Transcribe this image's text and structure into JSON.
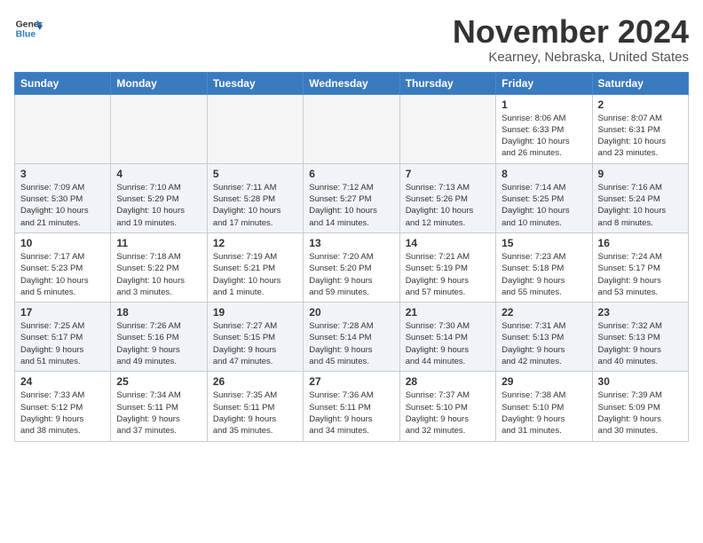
{
  "header": {
    "logo_general": "General",
    "logo_blue": "Blue",
    "month_title": "November 2024",
    "location": "Kearney, Nebraska, United States"
  },
  "weekdays": [
    "Sunday",
    "Monday",
    "Tuesday",
    "Wednesday",
    "Thursday",
    "Friday",
    "Saturday"
  ],
  "weeks": [
    [
      {
        "day": "",
        "info": ""
      },
      {
        "day": "",
        "info": ""
      },
      {
        "day": "",
        "info": ""
      },
      {
        "day": "",
        "info": ""
      },
      {
        "day": "",
        "info": ""
      },
      {
        "day": "1",
        "info": "Sunrise: 8:06 AM\nSunset: 6:33 PM\nDaylight: 10 hours\nand 26 minutes."
      },
      {
        "day": "2",
        "info": "Sunrise: 8:07 AM\nSunset: 6:31 PM\nDaylight: 10 hours\nand 23 minutes."
      }
    ],
    [
      {
        "day": "3",
        "info": "Sunrise: 7:09 AM\nSunset: 5:30 PM\nDaylight: 10 hours\nand 21 minutes."
      },
      {
        "day": "4",
        "info": "Sunrise: 7:10 AM\nSunset: 5:29 PM\nDaylight: 10 hours\nand 19 minutes."
      },
      {
        "day": "5",
        "info": "Sunrise: 7:11 AM\nSunset: 5:28 PM\nDaylight: 10 hours\nand 17 minutes."
      },
      {
        "day": "6",
        "info": "Sunrise: 7:12 AM\nSunset: 5:27 PM\nDaylight: 10 hours\nand 14 minutes."
      },
      {
        "day": "7",
        "info": "Sunrise: 7:13 AM\nSunset: 5:26 PM\nDaylight: 10 hours\nand 12 minutes."
      },
      {
        "day": "8",
        "info": "Sunrise: 7:14 AM\nSunset: 5:25 PM\nDaylight: 10 hours\nand 10 minutes."
      },
      {
        "day": "9",
        "info": "Sunrise: 7:16 AM\nSunset: 5:24 PM\nDaylight: 10 hours\nand 8 minutes."
      }
    ],
    [
      {
        "day": "10",
        "info": "Sunrise: 7:17 AM\nSunset: 5:23 PM\nDaylight: 10 hours\nand 5 minutes."
      },
      {
        "day": "11",
        "info": "Sunrise: 7:18 AM\nSunset: 5:22 PM\nDaylight: 10 hours\nand 3 minutes."
      },
      {
        "day": "12",
        "info": "Sunrise: 7:19 AM\nSunset: 5:21 PM\nDaylight: 10 hours\nand 1 minute."
      },
      {
        "day": "13",
        "info": "Sunrise: 7:20 AM\nSunset: 5:20 PM\nDaylight: 9 hours\nand 59 minutes."
      },
      {
        "day": "14",
        "info": "Sunrise: 7:21 AM\nSunset: 5:19 PM\nDaylight: 9 hours\nand 57 minutes."
      },
      {
        "day": "15",
        "info": "Sunrise: 7:23 AM\nSunset: 5:18 PM\nDaylight: 9 hours\nand 55 minutes."
      },
      {
        "day": "16",
        "info": "Sunrise: 7:24 AM\nSunset: 5:17 PM\nDaylight: 9 hours\nand 53 minutes."
      }
    ],
    [
      {
        "day": "17",
        "info": "Sunrise: 7:25 AM\nSunset: 5:17 PM\nDaylight: 9 hours\nand 51 minutes."
      },
      {
        "day": "18",
        "info": "Sunrise: 7:26 AM\nSunset: 5:16 PM\nDaylight: 9 hours\nand 49 minutes."
      },
      {
        "day": "19",
        "info": "Sunrise: 7:27 AM\nSunset: 5:15 PM\nDaylight: 9 hours\nand 47 minutes."
      },
      {
        "day": "20",
        "info": "Sunrise: 7:28 AM\nSunset: 5:14 PM\nDaylight: 9 hours\nand 45 minutes."
      },
      {
        "day": "21",
        "info": "Sunrise: 7:30 AM\nSunset: 5:14 PM\nDaylight: 9 hours\nand 44 minutes."
      },
      {
        "day": "22",
        "info": "Sunrise: 7:31 AM\nSunset: 5:13 PM\nDaylight: 9 hours\nand 42 minutes."
      },
      {
        "day": "23",
        "info": "Sunrise: 7:32 AM\nSunset: 5:13 PM\nDaylight: 9 hours\nand 40 minutes."
      }
    ],
    [
      {
        "day": "24",
        "info": "Sunrise: 7:33 AM\nSunset: 5:12 PM\nDaylight: 9 hours\nand 38 minutes."
      },
      {
        "day": "25",
        "info": "Sunrise: 7:34 AM\nSunset: 5:11 PM\nDaylight: 9 hours\nand 37 minutes."
      },
      {
        "day": "26",
        "info": "Sunrise: 7:35 AM\nSunset: 5:11 PM\nDaylight: 9 hours\nand 35 minutes."
      },
      {
        "day": "27",
        "info": "Sunrise: 7:36 AM\nSunset: 5:11 PM\nDaylight: 9 hours\nand 34 minutes."
      },
      {
        "day": "28",
        "info": "Sunrise: 7:37 AM\nSunset: 5:10 PM\nDaylight: 9 hours\nand 32 minutes."
      },
      {
        "day": "29",
        "info": "Sunrise: 7:38 AM\nSunset: 5:10 PM\nDaylight: 9 hours\nand 31 minutes."
      },
      {
        "day": "30",
        "info": "Sunrise: 7:39 AM\nSunset: 5:09 PM\nDaylight: 9 hours\nand 30 minutes."
      }
    ]
  ]
}
